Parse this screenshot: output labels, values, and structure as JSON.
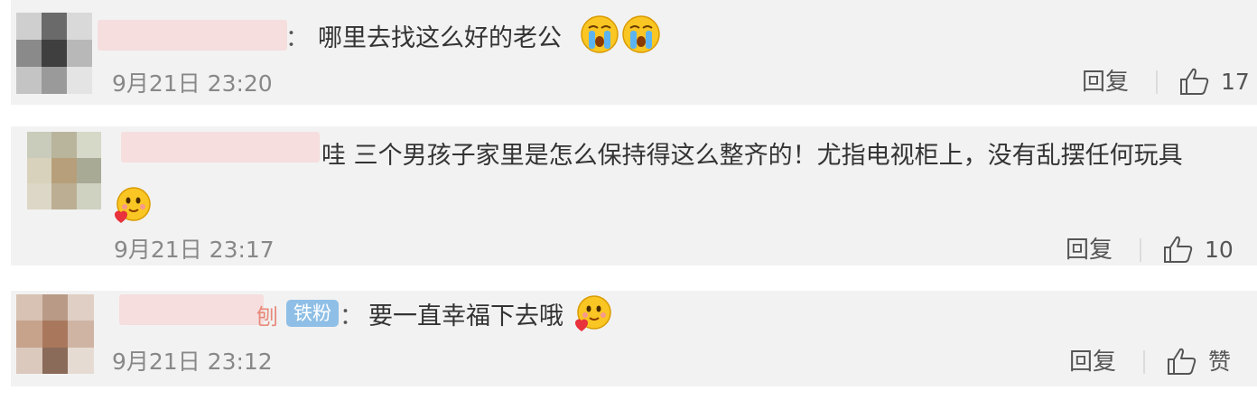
{
  "comments": [
    {
      "text": "哪里去找这么好的老公",
      "colon": "：",
      "timestamp": "9月21日 23:20",
      "reply_label": "回复",
      "like_count": "17",
      "emojis": [
        "crying-face-emoji",
        "crying-face-emoji"
      ]
    },
    {
      "text": "哇 三个男孩子家里是怎么保持得这么整齐的！尤指电视柜上，没有乱摆任何玩具",
      "timestamp": "9月21日 23:17",
      "reply_label": "回复",
      "like_count": "10",
      "emojis": [
        "heart-hug-face-emoji"
      ]
    },
    {
      "name_fragment": "刨",
      "badge": "铁粉",
      "colon": "：",
      "text": "要一直幸福下去哦",
      "timestamp": "9月21日 23:12",
      "reply_label": "回复",
      "like_label": "赞",
      "emojis": [
        "heart-hug-face-emoji"
      ]
    }
  ],
  "colors": {
    "card_background": "#f2f2f2",
    "badge_background": "#8fbfe6",
    "timestamp": "#888888",
    "text": "#333333"
  }
}
